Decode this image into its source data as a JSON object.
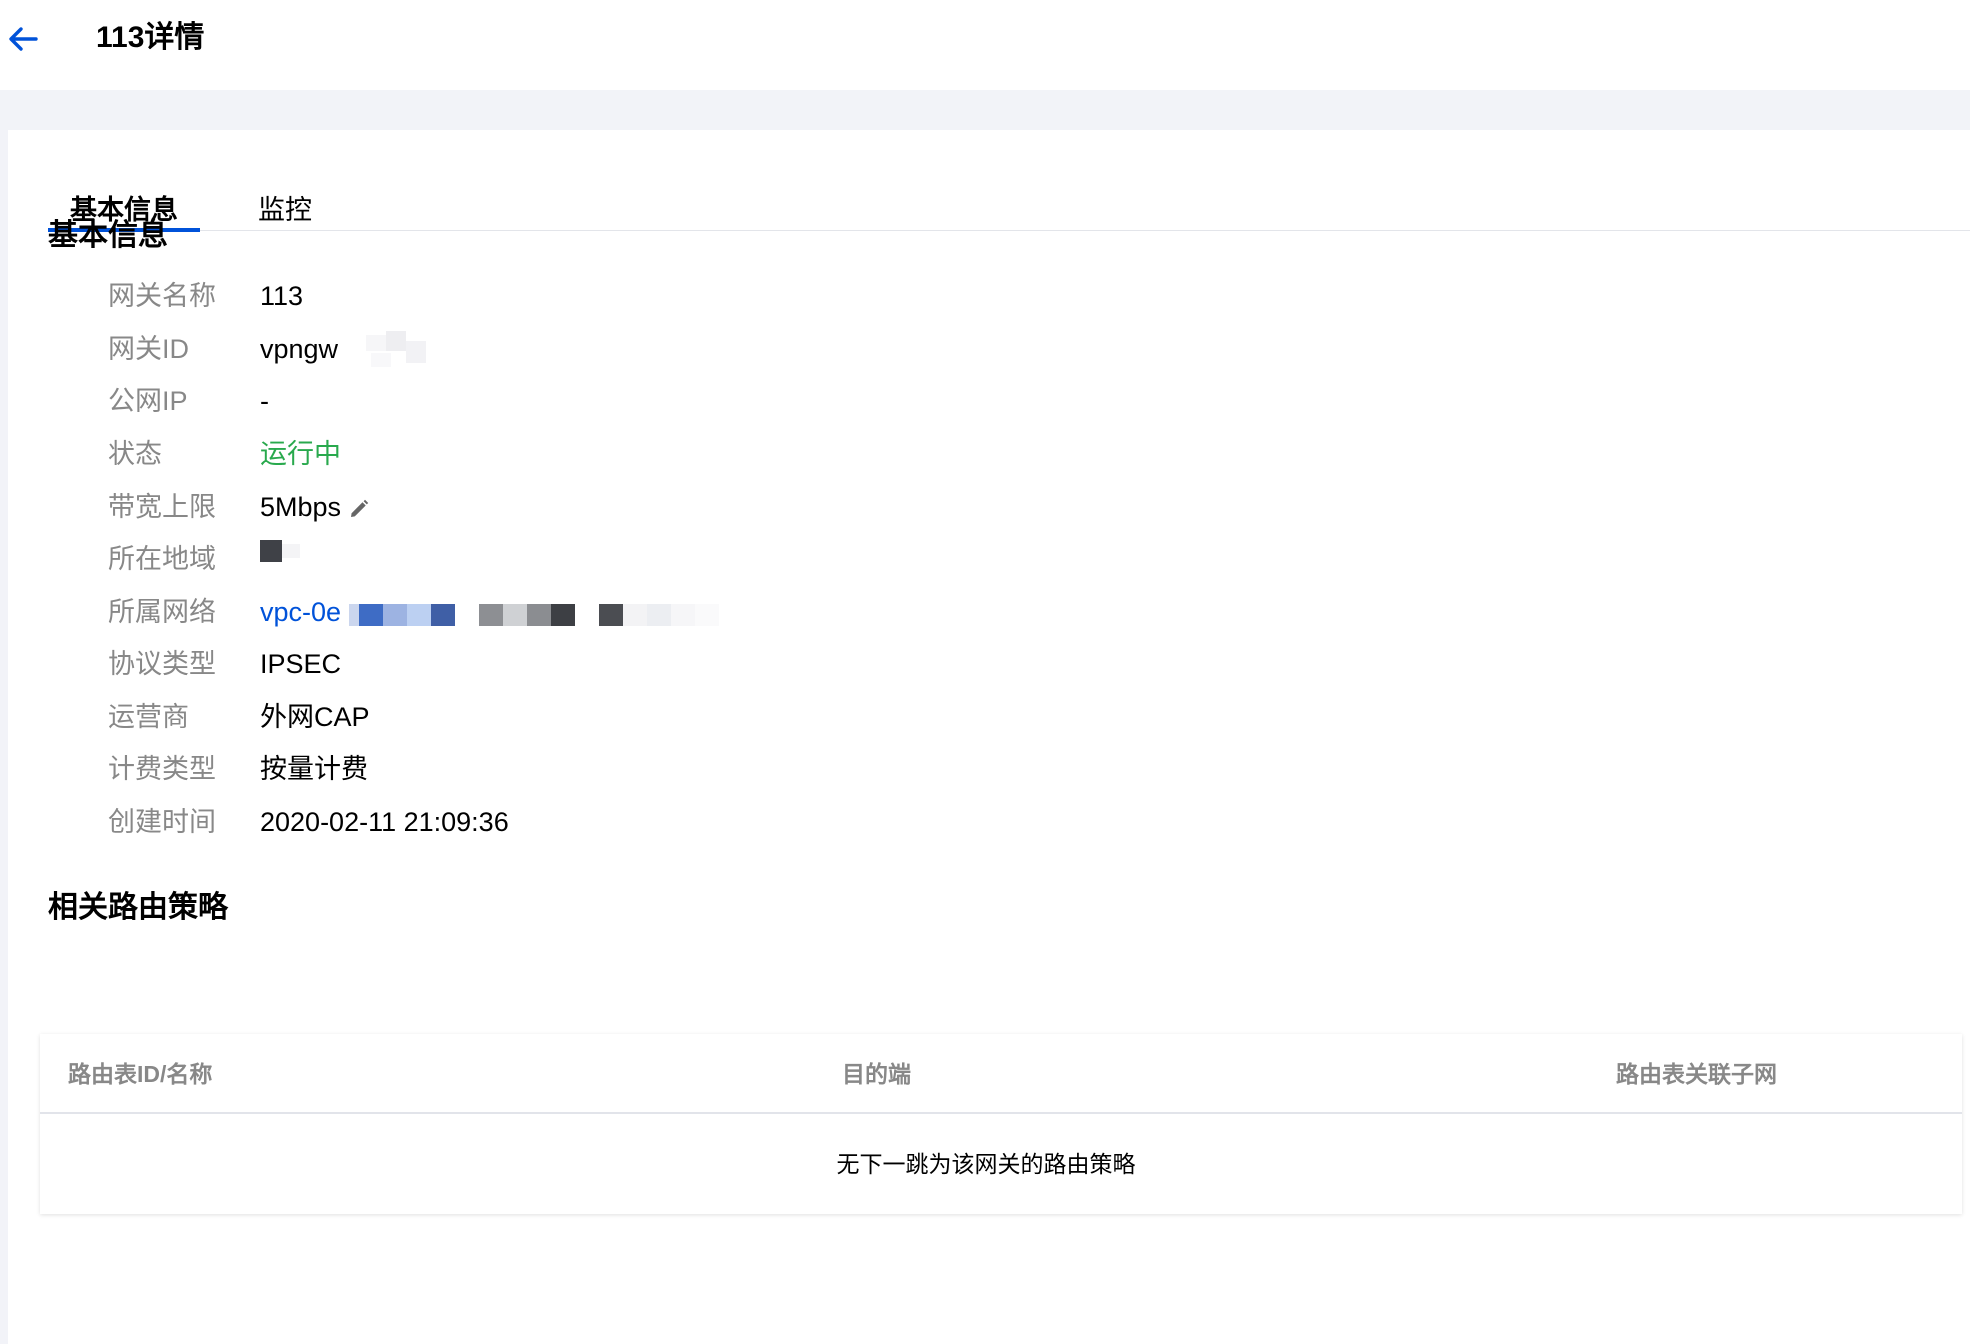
{
  "header": {
    "title": "113详情",
    "back_icon": "arrow-left-icon",
    "accent_color": "#0052d9"
  },
  "tabs": [
    {
      "label": "基本信息",
      "active": true
    },
    {
      "label": "监控",
      "active": false
    }
  ],
  "basic_info": {
    "section_title": "基本信息",
    "fields": [
      {
        "label": "网关名称",
        "value": "113"
      },
      {
        "label": "网关ID",
        "value": "vpngw"
      },
      {
        "label": "公网IP",
        "value": "-"
      },
      {
        "label": "状态",
        "value": "运行中",
        "color": "#29a94d"
      },
      {
        "label": "带宽上限",
        "value": "5Mbps",
        "icon": "pencil-edit-icon"
      },
      {
        "label": "所在地域",
        "value": ""
      },
      {
        "label": "所属网络",
        "value": "vpc-0e"
      },
      {
        "label": "协议类型",
        "value": "IPSEC"
      },
      {
        "label": "运营商",
        "value": "外网CAP"
      },
      {
        "label": "计费类型",
        "value": "按量计费"
      },
      {
        "label": "创建时间",
        "value": "2020-02-11 21:09:36"
      }
    ]
  },
  "route_policies": {
    "section_title": "相关路由策略",
    "columns": [
      "路由表ID/名称",
      "目的端",
      "路由表关联子网"
    ],
    "empty_text": "无下一跳为该网关的路由策略"
  }
}
